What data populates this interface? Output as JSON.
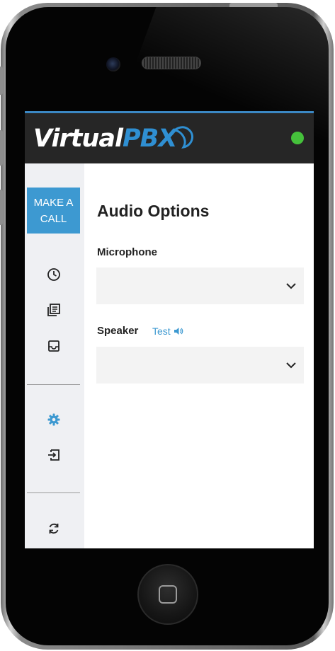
{
  "app": {
    "brand_left": "Virtual",
    "brand_right": "PBX",
    "status_color": "#45c13b",
    "accent": "#3d99d1"
  },
  "sidebar": {
    "make_call_label": "MAKE A CALL",
    "items": [
      {
        "name": "history",
        "icon": "clock-icon"
      },
      {
        "name": "contacts",
        "icon": "contacts-icon"
      },
      {
        "name": "voicemail",
        "icon": "inbox-icon"
      },
      {
        "name": "settings",
        "icon": "gear-icon"
      },
      {
        "name": "sign-out",
        "icon": "logout-icon"
      },
      {
        "name": "refresh",
        "icon": "refresh-icon"
      }
    ]
  },
  "main": {
    "title": "Audio Options",
    "microphone": {
      "label": "Microphone",
      "value": ""
    },
    "speaker": {
      "label": "Speaker",
      "test_label": "Test",
      "value": ""
    }
  }
}
